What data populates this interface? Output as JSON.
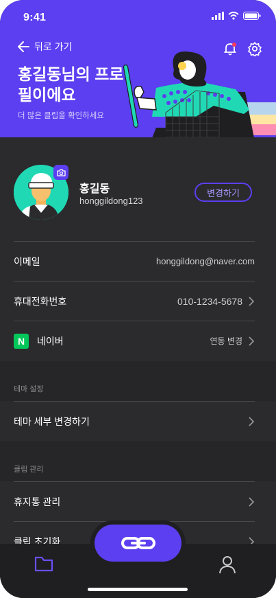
{
  "status": {
    "time": "9:41"
  },
  "header": {
    "back_label": "뒤로 가기",
    "title": "홍길동님의 프로필이에요",
    "subtitle": "더 많은 클립을 확인하세요"
  },
  "icons": {
    "back": "arrow-left-icon",
    "notification": "bell-icon",
    "settings": "gear-icon",
    "camera": "camera-icon",
    "link": "link-icon",
    "folder": "folder-icon",
    "user": "user-icon"
  },
  "profile": {
    "name": "홍길동",
    "username": "honggildong123",
    "edit_label": "변경하기"
  },
  "account": {
    "email_label": "이메일",
    "email_value": "honggildong@naver.com",
    "phone_label": "휴대전화번호",
    "phone_value": "010-1234-5678",
    "naver_badge": "N",
    "naver_label": "네이버",
    "naver_action": "연동 변경"
  },
  "theme": {
    "section_label": "테마 설정",
    "detail_label": "테마 세부 변경하기"
  },
  "clip": {
    "section_label": "클립 관리",
    "trash_label": "휴지통 관리",
    "reset_label": "클립 초기화"
  },
  "colors": {
    "accent": "#5b3ff0",
    "teal": "#20d9b4",
    "background": "#2b2b2d",
    "naver": "#03c75a"
  }
}
